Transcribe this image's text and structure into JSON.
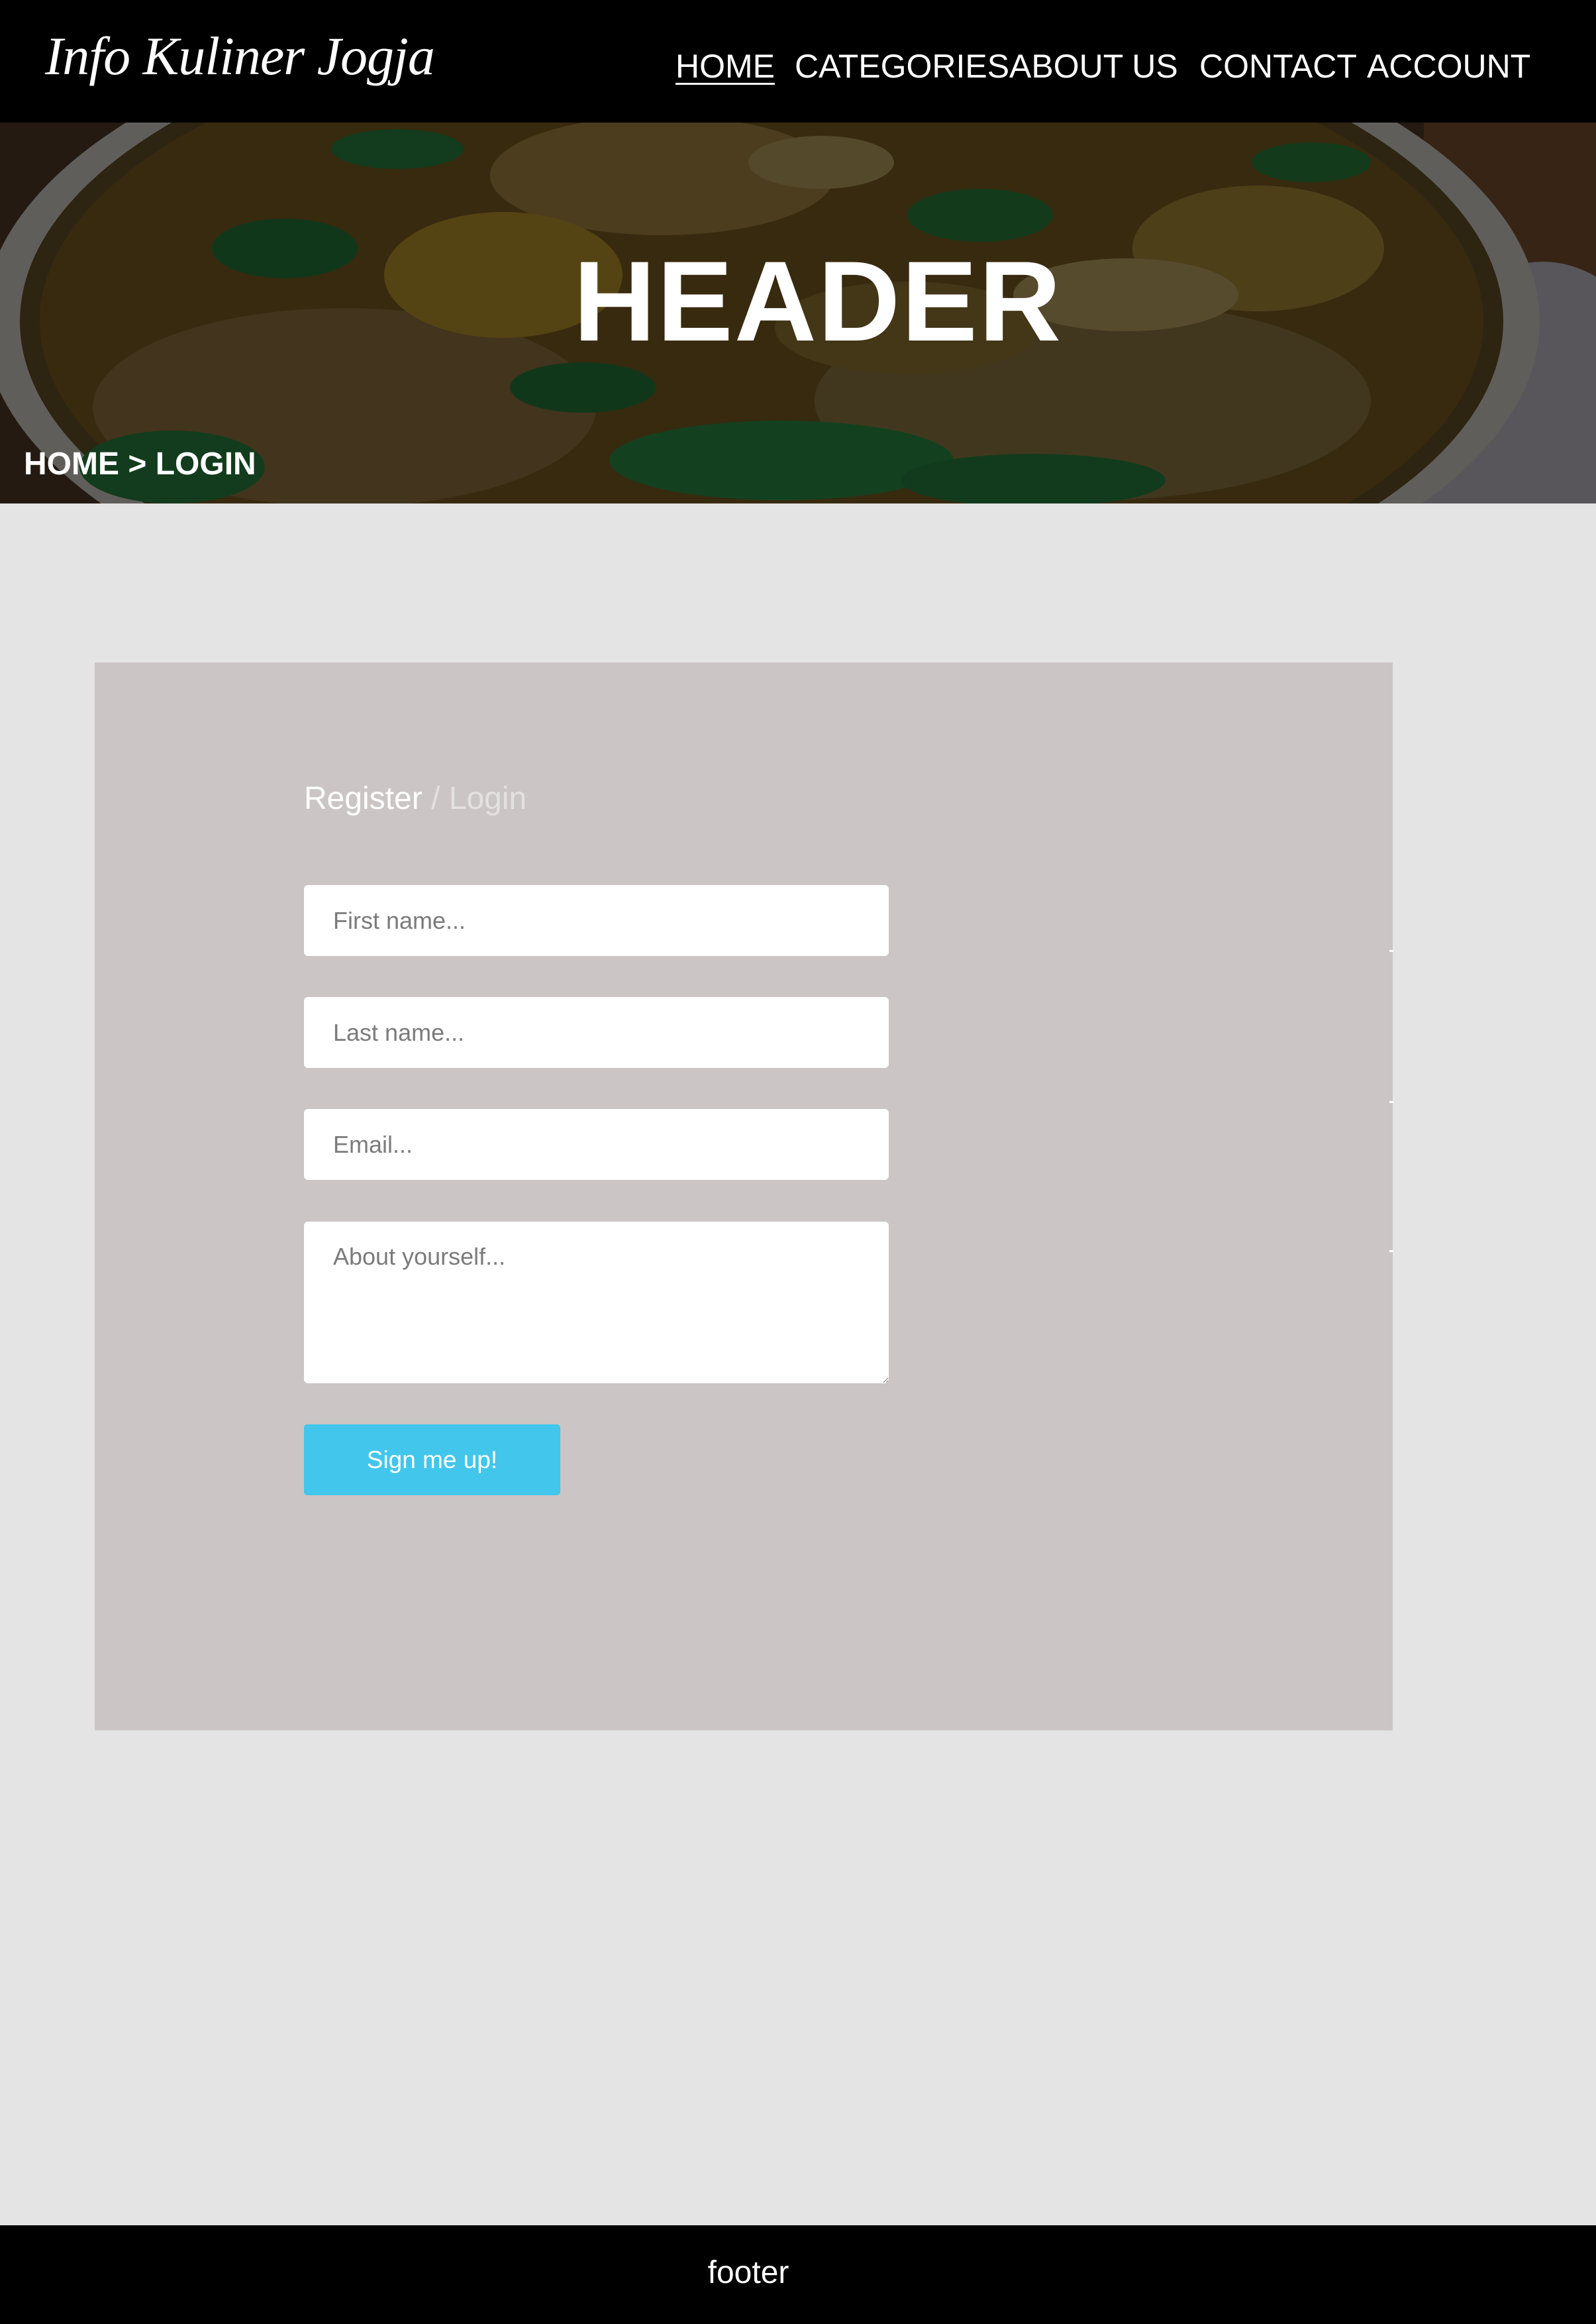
{
  "brand": "Info Kuliner Jogja",
  "nav": {
    "home": "HOME",
    "categories": "CATEGORIES",
    "about": "ABOUT US",
    "contact": "CONTACT",
    "account": "ACCOUNT"
  },
  "hero": {
    "title": "HEADER",
    "breadcrumb": {
      "home": "HOME",
      "separator": ">",
      "current": "LOGIN"
    }
  },
  "form": {
    "heading_register": "Register",
    "heading_separator": "/",
    "heading_login": "Login",
    "first_name_placeholder": "First name...",
    "last_name_placeholder": "Last name...",
    "email_placeholder": "Email...",
    "about_placeholder": "About yourself...",
    "submit_label": "Sign me up!"
  },
  "footer": {
    "text": "footer"
  },
  "colors": {
    "nav_bg": "#000000",
    "page_bg": "#e5e4e4",
    "panel_bg": "#cbc5c6",
    "button_bg": "#42c6eb",
    "text_light": "#ffffff"
  }
}
